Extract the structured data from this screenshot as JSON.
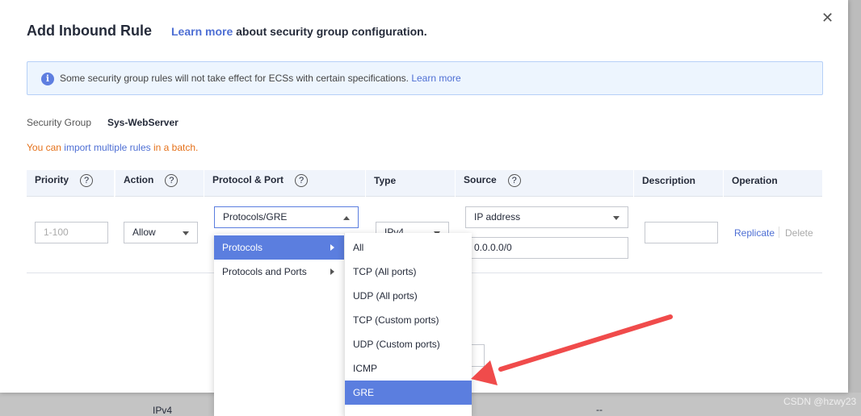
{
  "background": {
    "row_type": "IPv4",
    "row_desc": "--"
  },
  "modal": {
    "title": "Add Inbound Rule",
    "learn_more": "Learn more",
    "subtitle_rest": "about security group configuration.",
    "close_icon": "close-icon",
    "info": {
      "text": "Some security group rules will not take effect for ECSs with certain specifications.",
      "link": "Learn more"
    },
    "security_group_label": "Security Group",
    "security_group_value": "Sys-WebServer",
    "batch": {
      "prefix": "You can",
      "link": "import multiple rules",
      "suffix": "in a batch."
    },
    "columns": [
      "Priority",
      "Action",
      "Protocol & Port",
      "Type",
      "Source",
      "Description",
      "Operation"
    ],
    "row": {
      "priority_placeholder": "1-100",
      "action": "Allow",
      "protocol": "Protocols/GRE",
      "type": "IPv4",
      "source_type": "IP address",
      "source_value": "0.0.0.0/0",
      "description": "",
      "replicate": "Replicate",
      "delete": "Delete"
    },
    "dropdown": {
      "categories": [
        "Protocols",
        "Protocols and Ports"
      ],
      "selected_category": "Protocols",
      "options": [
        "All",
        "TCP (All ports)",
        "UDP (All ports)",
        "TCP (Custom ports)",
        "UDP (Custom ports)",
        "ICMP",
        "GRE"
      ],
      "selected_option": "GRE"
    }
  },
  "watermark": "CSDN @hzwy23",
  "colors": {
    "accent": "#5b7edf",
    "link": "#4e6fd4",
    "warning_text": "#e5711a",
    "arrow": "#f04b4b"
  }
}
